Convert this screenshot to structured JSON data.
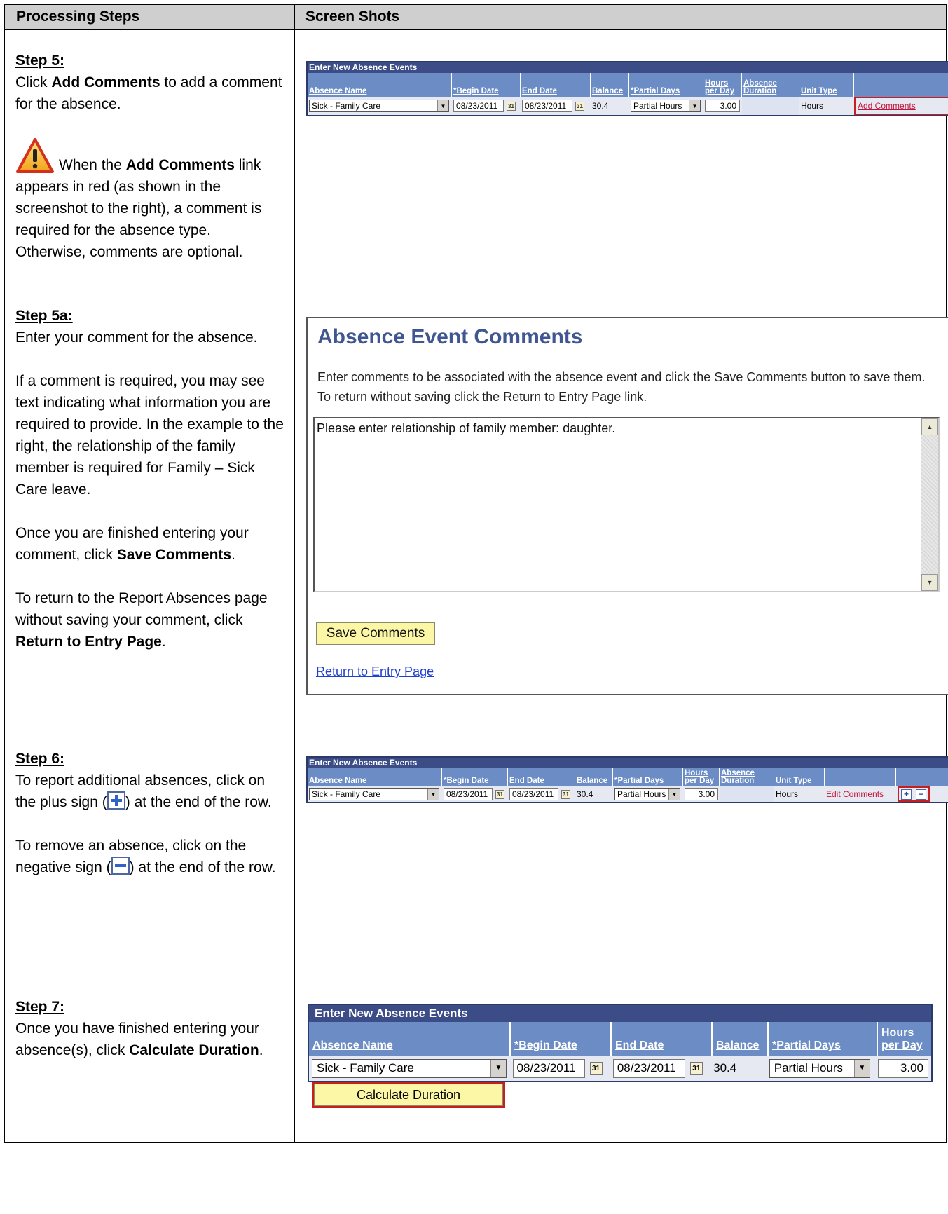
{
  "headers": {
    "left": "Processing Steps",
    "right": "Screen Shots"
  },
  "step5": {
    "title": "Step 5:",
    "p1_pre": "Click ",
    "p1_bold": "Add Comments",
    "p1_post": " to add a comment for the absence.",
    "warn_pre": "When the ",
    "warn_bold": "Add Comments",
    "warn_post": " link appears in red (as shown in the screenshot to the right), a comment is required for the absence type. Otherwise, comments are optional."
  },
  "step5a": {
    "title": "Step 5a:",
    "p1": "Enter your comment for the absence.",
    "p2": "If a comment is required, you may see text indicating what information you are required to provide. In the example to the right, the relationship of the family member is required for Family – Sick Care leave.",
    "p3_pre": "Once you are finished entering your comment, click ",
    "p3_bold": "Save Comments",
    "p3_post": ".",
    "p4_pre": "To return to the Report Absences page without saving your comment, click ",
    "p4_bold": "Return to Entry Page",
    "p4_post": "."
  },
  "step6": {
    "title": "Step 6:",
    "p1_pre": "To report additional absences, click on the plus sign (",
    "p1_post": ") at the end of the row.",
    "p2_pre": "To remove an absence, click on the negative sign (",
    "p2_post": ") at the end of the row."
  },
  "step7": {
    "title": "Step 7:",
    "p1_pre": "Once you have finished entering your absence(s), click ",
    "p1_bold": "Calculate Duration",
    "p1_post": "."
  },
  "grid": {
    "title": "Enter New Absence Events",
    "col_absence_name": "Absence Name",
    "col_begin_date": "*Begin Date",
    "col_end_date": "End Date",
    "col_balance": "Balance",
    "col_partial_days": "*Partial Days",
    "col_hours_per_day": "Hours per Day",
    "col_absence_duration": "Absence Duration",
    "col_unit_type": "Unit Type",
    "row": {
      "absence_name": "Sick - Family Care",
      "begin_date": "08/23/2011",
      "end_date": "08/23/2011",
      "balance": "30.4",
      "partial_days": "Partial Hours",
      "hours_per_day": "3.00",
      "absence_duration": "",
      "unit_type": "Hours"
    },
    "add_comments": "Add Comments",
    "edit_comments": "Edit Comments",
    "plus": "+",
    "minus": "−"
  },
  "comments_page": {
    "title": "Absence Event Comments",
    "instructions": "Enter comments to be associated with the absence event and click the Save Comments button to save them. To return without saving click the Return to Entry Page link.",
    "comment_text": "Please enter relationship of family member: daughter.",
    "save_button": "Save Comments",
    "return_link": "Return to Entry Page"
  },
  "calculate_button": "Calculate Duration",
  "colors": {
    "header_bg": "#cfcfcf",
    "grid_title": "#3b4c86",
    "grid_head": "#6b8cc4",
    "highlight": "#c81e1e",
    "button": "#fbf7a6",
    "comments_title": "#3f5690"
  },
  "icons": {
    "warning": "warning-triangle-icon",
    "calendar": "calendar-icon",
    "dropdown": "chevron-down-icon"
  }
}
